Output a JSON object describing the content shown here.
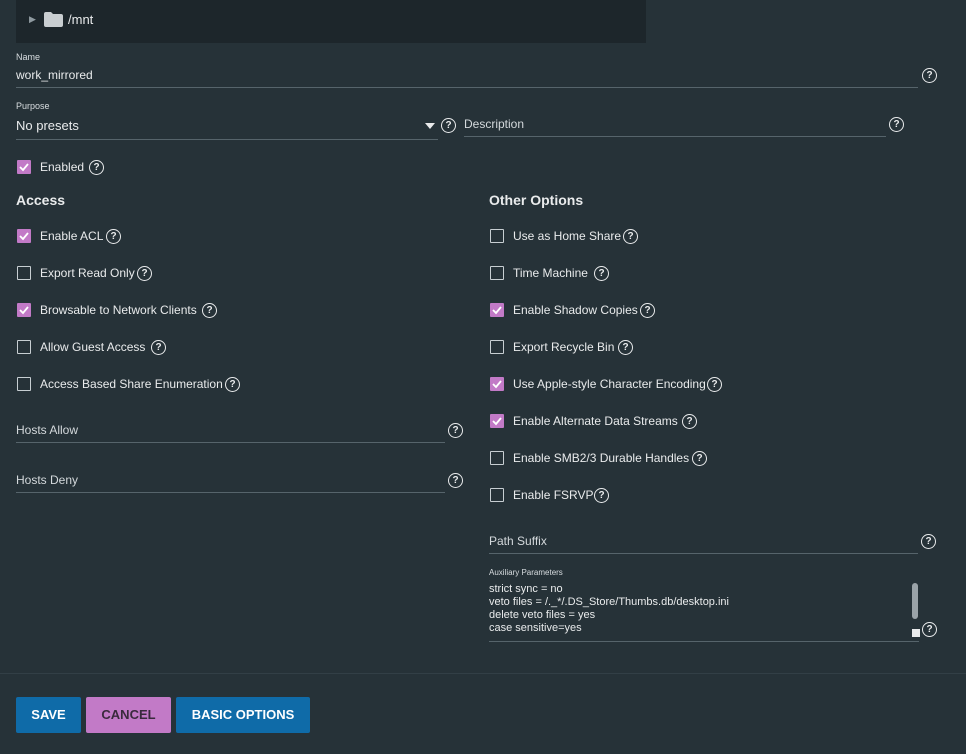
{
  "tree": {
    "path": "/mnt"
  },
  "name": {
    "label": "Name",
    "value": "work_mirrored"
  },
  "purpose": {
    "label": "Purpose",
    "value": "No presets"
  },
  "description": {
    "placeholder": "Description"
  },
  "enabled": {
    "label": "Enabled",
    "checked": true
  },
  "access": {
    "title": "Access",
    "options": [
      {
        "label": "Enable ACL",
        "checked": true
      },
      {
        "label": "Export Read Only",
        "checked": false
      },
      {
        "label": "Browsable to Network Clients",
        "checked": true
      },
      {
        "label": "Allow Guest Access",
        "checked": false
      },
      {
        "label": "Access Based Share Enumeration",
        "checked": false
      }
    ],
    "hosts_allow": "Hosts Allow",
    "hosts_deny": "Hosts Deny"
  },
  "other": {
    "title": "Other Options",
    "options": [
      {
        "label": "Use as Home Share",
        "checked": false
      },
      {
        "label": "Time Machine",
        "checked": false
      },
      {
        "label": "Enable Shadow Copies",
        "checked": true
      },
      {
        "label": "Export Recycle Bin",
        "checked": false
      },
      {
        "label": "Use Apple-style Character Encoding",
        "checked": true
      },
      {
        "label": "Enable Alternate Data Streams",
        "checked": true
      },
      {
        "label": "Enable SMB2/3 Durable Handles",
        "checked": false
      },
      {
        "label": "Enable FSRVP",
        "checked": false
      }
    ],
    "path_suffix": "Path Suffix"
  },
  "aux": {
    "label": "Auxiliary Parameters",
    "lines": [
      "strict sync = no",
      "veto files = /._*/.DS_Store/Thumbs.db/desktop.ini",
      "delete veto files = yes",
      "case sensitive=yes"
    ]
  },
  "buttons": {
    "save": "SAVE",
    "cancel": "CANCEL",
    "basic": "BASIC OPTIONS"
  },
  "icons": {
    "help": "?",
    "expand": "▶"
  },
  "colors": {
    "accent": "#c27ac7",
    "primary": "#0f6ba8",
    "background": "#263238"
  }
}
